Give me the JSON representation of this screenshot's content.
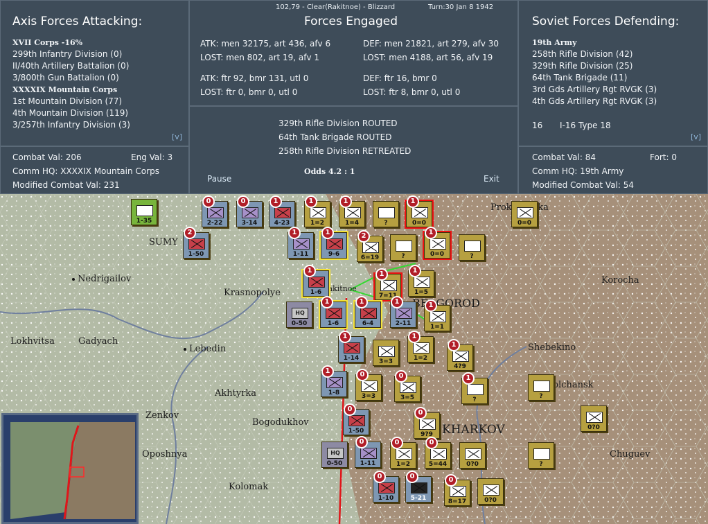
{
  "status_bar": {
    "coords": "102,79 - Clear(Rakitnoe) - Blizzard",
    "turn": "Turn:30  Jan 8 1942"
  },
  "axis": {
    "title": "Axis Forces Attacking:",
    "units": [
      {
        "label": "XVII Corps  -16%",
        "bold": true
      },
      {
        "label": "299th Infantry Division (0)"
      },
      {
        "label": "II/40th Artillery Battalion (0)"
      },
      {
        "label": "3/800th Gun Battalion (0)"
      },
      {
        "label": "XXXXIX Mountain Corps",
        "bold": true
      },
      {
        "label": "1st Mountain Division (77)"
      },
      {
        "label": "4th Mountain Division (119)"
      },
      {
        "label": "3/257th Infantry Division (3)"
      }
    ],
    "expand": "[v]",
    "combat_val": "Combat Val: 206",
    "eng_val": "Eng Val: 3",
    "comm_hq": "Comm HQ: XXXXIX Mountain Corps",
    "modified": "Modified Combat Val: 231"
  },
  "forces": {
    "title": "Forces Engaged",
    "atk1": "ATK: men 32175, art 436, afv 6",
    "lost1": "LOST: men 802, art 19, afv 1",
    "def1": "DEF: men 21821, art 279, afv 30",
    "dlost1": "LOST: men 4188, art 56, afv 19",
    "atk2": "ATK: ftr 92, bmr 131, utl 0",
    "lost2": "LOST: ftr 0, bmr 0, utl 0",
    "def2": "DEF: ftr 16, bmr 0",
    "dlost2": "LOST: ftr 8, bmr 0, utl 0",
    "results": [
      "329th Rifle Division ROUTED",
      "64th Tank Brigade ROUTED",
      "258th Rifle Division RETREATED"
    ],
    "odds": "Odds 4.2 : 1",
    "pause": "Pause",
    "exit": "Exit"
  },
  "soviet": {
    "title": "Soviet Forces Defending:",
    "units": [
      {
        "label": "19th Army",
        "bold": true
      },
      {
        "label": "258th Rifle Division (42)"
      },
      {
        "label": "329th Rifle Division (25)"
      },
      {
        "label": "64th Tank Brigade (11)"
      },
      {
        "label": "3rd Gds Artillery Rgt RVGK (3)"
      },
      {
        "label": "4th Gds Artillery Rgt RVGK (3)"
      }
    ],
    "air_count": "16",
    "air_type": "I-16 Type 18",
    "expand": "[v]",
    "combat_val": "Combat Val: 84",
    "fort": "Fort: 0",
    "comm_hq": "Comm HQ: 19th Army",
    "modified": "Modified Combat Val: 54"
  },
  "map": {
    "towns": [
      "SUMY",
      "Nedrigailov",
      "Krasnopolye",
      "Lokhvitsa",
      "Gadyach",
      "Lebedin",
      "Akhtyrka",
      "Bogodukhov",
      "Zenkov",
      "Oposhnya",
      "Kolomak",
      "Shebekino",
      "Volchansk",
      "KHARKOV",
      "Korocha",
      "Prokhorovka",
      "BELGOROD",
      "Chuguev",
      "Rakitnoe"
    ],
    "counters": [
      {
        "id": "c1",
        "val": "1-35",
        "kind": "green"
      },
      {
        "id": "c2",
        "val": "2-22",
        "kind": "axis",
        "badge": "0"
      },
      {
        "id": "c3",
        "val": "3-14",
        "kind": "axis",
        "badge": "0"
      },
      {
        "id": "c4",
        "val": "4-23",
        "kind": "axis",
        "badge": "1"
      },
      {
        "id": "c5",
        "val": "1=2",
        "kind": "sov",
        "badge": "1"
      },
      {
        "id": "c6",
        "val": "1=4",
        "kind": "sov",
        "badge": "1"
      },
      {
        "id": "c7",
        "val": "?",
        "kind": "sov"
      },
      {
        "id": "c8",
        "val": "0=0",
        "kind": "sov",
        "badge": "1",
        "outline": "red"
      },
      {
        "id": "c9",
        "val": "0=0",
        "kind": "sov"
      },
      {
        "id": "c10",
        "val": "1-50",
        "kind": "axis",
        "badge": "2"
      },
      {
        "id": "c11",
        "val": "1-11",
        "kind": "axis",
        "badge": "1"
      },
      {
        "id": "c12",
        "val": "9-6",
        "kind": "axis",
        "badge": "1",
        "outline": "yellow"
      },
      {
        "id": "c13",
        "val": "6=19",
        "kind": "sov",
        "badge": "2"
      },
      {
        "id": "c14",
        "val": "?",
        "kind": "sov"
      },
      {
        "id": "c15",
        "val": "0=0",
        "kind": "sov",
        "badge": "1",
        "outline": "red"
      },
      {
        "id": "c16",
        "val": "?",
        "kind": "sov"
      },
      {
        "id": "c17",
        "val": "1-6",
        "kind": "axis",
        "badge": "1",
        "outline": "yellow"
      },
      {
        "id": "c18",
        "val": "7=11",
        "kind": "sov",
        "badge": "1",
        "outline": "red"
      },
      {
        "id": "c19",
        "val": "1=5",
        "kind": "sov",
        "badge": "1"
      },
      {
        "id": "c20",
        "val": "0-50",
        "kind": "hq"
      },
      {
        "id": "c21",
        "val": "1-6",
        "kind": "axis",
        "badge": "1",
        "outline": "yellow"
      },
      {
        "id": "c22",
        "val": "6-4",
        "kind": "axis",
        "badge": "1",
        "outline": "yellow"
      },
      {
        "id": "c23",
        "val": "2-11",
        "kind": "axis",
        "badge": "1"
      },
      {
        "id": "c24",
        "val": "1=1",
        "kind": "sov",
        "badge": "1"
      },
      {
        "id": "c25",
        "val": "1-14",
        "kind": "axis",
        "badge": "1"
      },
      {
        "id": "c26",
        "val": "3=3",
        "kind": "sov"
      },
      {
        "id": "c27",
        "val": "1=2",
        "kind": "sov",
        "badge": "1"
      },
      {
        "id": "c28",
        "val": "4?9",
        "kind": "sov",
        "badge": "1"
      },
      {
        "id": "c29",
        "val": "1-8",
        "kind": "axis",
        "badge": "1"
      },
      {
        "id": "c30",
        "val": "3=3",
        "kind": "sov",
        "badge": "0"
      },
      {
        "id": "c31",
        "val": "3=5",
        "kind": "sov",
        "badge": "0"
      },
      {
        "id": "c32",
        "val": "?",
        "kind": "sov",
        "badge": "1"
      },
      {
        "id": "c33",
        "val": "?",
        "kind": "sov"
      },
      {
        "id": "c34",
        "val": "1-50",
        "kind": "axis",
        "badge": "0"
      },
      {
        "id": "c35",
        "val": "9?9",
        "kind": "sov",
        "badge": "0"
      },
      {
        "id": "c36",
        "val": "0?0",
        "kind": "sov"
      },
      {
        "id": "c37",
        "val": "0-50",
        "kind": "hq"
      },
      {
        "id": "c38",
        "val": "1-11",
        "kind": "axis",
        "badge": "0"
      },
      {
        "id": "c39",
        "val": "1=2",
        "kind": "sov",
        "badge": "0"
      },
      {
        "id": "c40",
        "val": "5=44",
        "kind": "sov",
        "badge": "0"
      },
      {
        "id": "c41",
        "val": "0?0",
        "kind": "sov"
      },
      {
        "id": "c42",
        "val": "?",
        "kind": "sov"
      },
      {
        "id": "c43",
        "val": "1-10",
        "kind": "axis",
        "badge": "0"
      },
      {
        "id": "c44",
        "val": "5-21",
        "kind": "black",
        "badge": "0"
      },
      {
        "id": "c45",
        "val": "8=17",
        "kind": "sov",
        "badge": "0"
      },
      {
        "id": "c46",
        "val": "0?0",
        "kind": "sov"
      }
    ]
  },
  "colors": {
    "panel": "#3e4c59",
    "axis_unit": "#7e97b3",
    "soviet_unit": "#b6a040",
    "front_line": "#e0161a"
  }
}
